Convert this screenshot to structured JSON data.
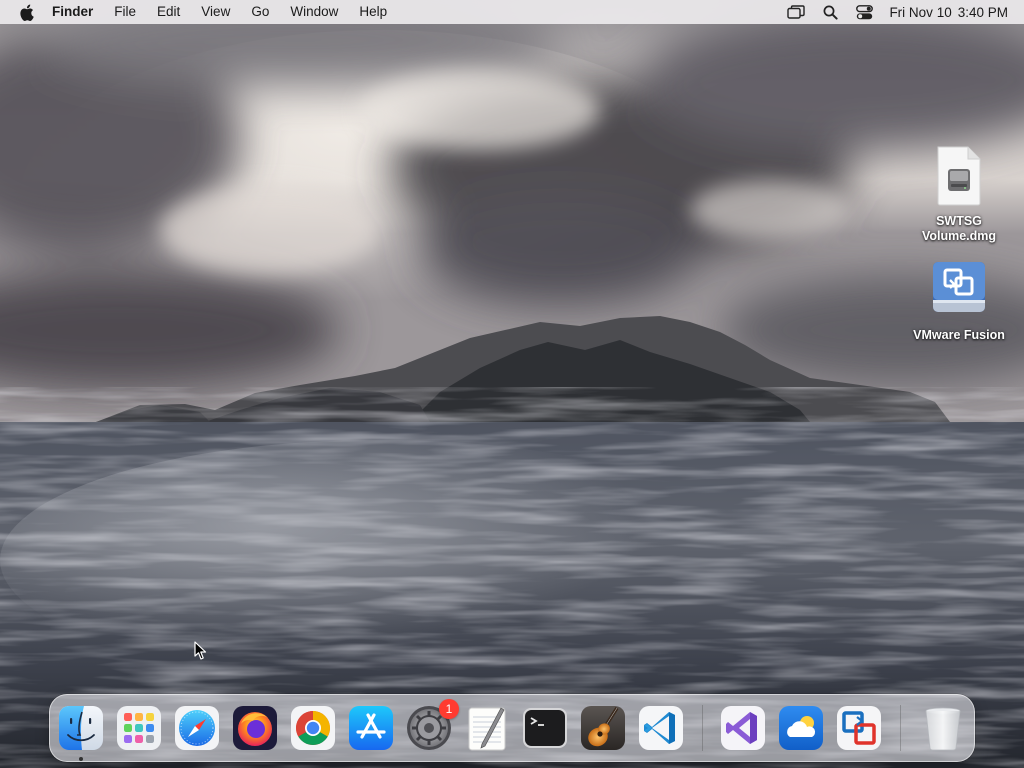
{
  "menubar": {
    "app_name": "Finder",
    "menus": [
      "File",
      "Edit",
      "View",
      "Go",
      "Window",
      "Help"
    ],
    "clock": {
      "date": "Fri Nov 10",
      "time": "3:40 PM"
    },
    "status_icons": [
      "screen-mirroring-icon",
      "spotlight-search-icon",
      "control-center-icon"
    ]
  },
  "desktop": {
    "icons": [
      {
        "label": "SWTSG\nVolume.dmg",
        "icon": "disk-image-icon"
      },
      {
        "label": "VMware Fusion",
        "icon": "vmware-fusion-volume-icon"
      }
    ]
  },
  "dock": {
    "apps": [
      {
        "name": "Finder",
        "icon": "finder-icon",
        "running": true
      },
      {
        "name": "Launchpad",
        "icon": "launchpad-icon"
      },
      {
        "name": "Safari",
        "icon": "safari-icon"
      },
      {
        "name": "Firefox",
        "icon": "firefox-icon"
      },
      {
        "name": "Chrome",
        "icon": "chrome-icon"
      },
      {
        "name": "App Store",
        "icon": "app-store-icon"
      },
      {
        "name": "System Settings",
        "icon": "system-settings-icon",
        "badge": "1"
      },
      {
        "name": "TextEdit",
        "icon": "textedit-icon"
      },
      {
        "name": "Terminal",
        "icon": "terminal-icon"
      },
      {
        "name": "GarageBand",
        "icon": "garageband-icon"
      },
      {
        "name": "Visual Studio Code",
        "icon": "vscode-icon"
      },
      {
        "name": "Visual Studio",
        "icon": "visual-studio-icon"
      },
      {
        "name": "Weather",
        "icon": "weather-icon"
      },
      {
        "name": "VMware Fusion",
        "icon": "vmware-fusion-icon"
      },
      {
        "name": "Trash",
        "icon": "trash-icon"
      }
    ]
  },
  "colors": {
    "menubar_bg": "#eceaec",
    "badge_red": "#ff3b30",
    "vscode_blue": "#1f8ad2",
    "vs_purple": "#8a5bd6"
  }
}
